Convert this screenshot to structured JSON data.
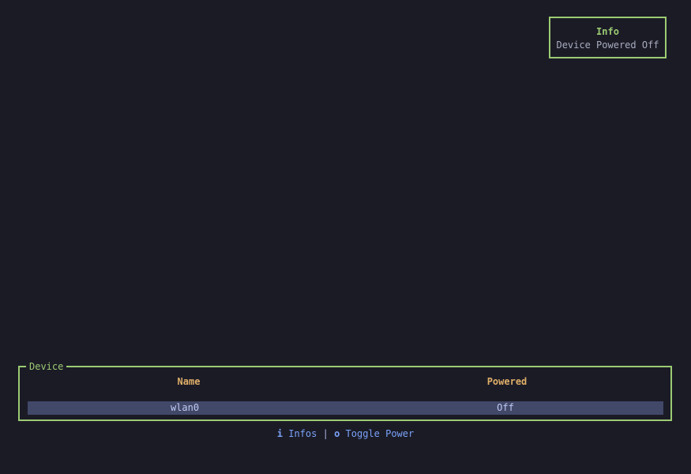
{
  "info_popup": {
    "title": "Info",
    "message": "Device Powered Off"
  },
  "device_panel": {
    "title": "Device",
    "columns": [
      "Name",
      "Powered"
    ],
    "rows": [
      {
        "name": "wlan0",
        "powered": "Off",
        "selected": true
      }
    ]
  },
  "help_bar": {
    "items": [
      {
        "key": "i",
        "label": "Infos"
      },
      {
        "key": "o",
        "label": "Toggle Power"
      }
    ],
    "separator": "|"
  },
  "colors": {
    "background": "#1b1b26",
    "border": "#9ccb72",
    "header": "#e0af68",
    "selection": "#414868",
    "help": "#7aa2f7"
  }
}
